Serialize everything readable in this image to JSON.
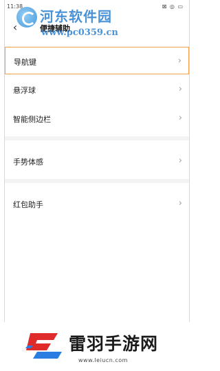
{
  "status_bar": {
    "time": "11:38",
    "icons": "⊠ ◎ ▭"
  },
  "header": {
    "title": "便捷辅助",
    "back_icon": "‹"
  },
  "watermark": {
    "site_name": "河东软件园",
    "site_url": "www.pc0359.cn"
  },
  "menu": {
    "items": [
      {
        "label": "导航键",
        "selected": true
      },
      {
        "label": "悬浮球",
        "selected": false
      },
      {
        "label": "智能侧边栏",
        "selected": false
      },
      {
        "label": "手势体感",
        "selected": false
      },
      {
        "label": "红包助手",
        "selected": false
      }
    ],
    "chevron": "›"
  },
  "footer_brand": {
    "name": "雷羽手游网",
    "url": "www.leiucn.com",
    "colors": {
      "red": "#e02b2b",
      "blue": "#2a7de1"
    }
  }
}
